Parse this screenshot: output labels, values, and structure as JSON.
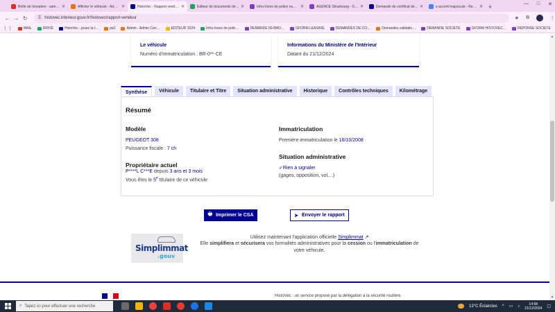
{
  "browser": {
    "tabs": [
      {
        "title": "Boîte de réception - sam…",
        "color": "#d93025",
        "active": false
      },
      {
        "title": "Afficher le véhicule - Adm…",
        "color": "#e8730c",
        "active": false
      },
      {
        "title": "HistoVec - Rapport vendeur",
        "color": "#000091",
        "active": true
      },
      {
        "title": "Editeur de documents de…",
        "color": "#1aa260",
        "active": false
      },
      {
        "title": "Infos livres de police num…",
        "color": "#7b3fbf",
        "active": false
      },
      {
        "title": "AGENCE Strasbourg - Gm…",
        "color": "#7b3fbf",
        "active": false
      },
      {
        "title": "Demande de certificat de…",
        "color": "#000091",
        "active": false
      },
      {
        "title": "e accent majuscule - Rech…",
        "color": "#4285f4",
        "active": false
      }
    ],
    "new_tab": "+",
    "url": "histovec.interieur.gouv.fr/histovec/rapport-vendeur",
    "bookmarks": [
      {
        "label": "MAIL",
        "color": "#d93025"
      },
      {
        "label": "DRIVE",
        "color": "#1aa260"
      },
      {
        "label": "HistoVec - jouez la t…",
        "color": "#000091"
      },
      {
        "label": "pa2",
        "color": "#e8730c"
      },
      {
        "label": "Admin - Admin Cen…",
        "color": "#e8730c"
      },
      {
        "label": "EDITEUR 2024",
        "color": "#f4b400"
      },
      {
        "label": "Infos livres de polic…",
        "color": "#1aa260"
      },
      {
        "label": "DEMANDE 60-8MO…",
        "color": "#7b3fbf"
      },
      {
        "label": "GFORM LEASING",
        "color": "#7b3fbf"
      },
      {
        "label": "DEMANDES DE CO…",
        "color": "#7b3fbf"
      },
      {
        "label": "Demandes validatio…",
        "color": "#e8730c"
      },
      {
        "label": "DEMANDE SOCIETE",
        "color": "#7b3fbf"
      },
      {
        "label": "GFORM HISTOVEC…",
        "color": "#7b3fbf"
      },
      {
        "label": "REPONSE SOCIETE",
        "color": "#7b3fbf"
      }
    ]
  },
  "cards": {
    "vehicle": {
      "title": "Le véhicule",
      "sub": "Numéro d'immatriculation : BR-0**-CE"
    },
    "ministry": {
      "title": "Informations du Ministère de l'Intérieur",
      "sub": "Datant du 21/12/2024"
    }
  },
  "tabs": [
    "Synthèse",
    "Véhicule",
    "Titulaire et Titre",
    "Situation administrative",
    "Historique",
    "Contrôles techniques",
    "Kilométrage"
  ],
  "summary": {
    "title": "Résumé",
    "model": {
      "heading": "Modèle",
      "name": "PEUGEOT 308",
      "power_label": "Puissance fiscale : ",
      "power_value": "7 ch"
    },
    "registration": {
      "heading": "Immatriculation",
      "first_label": "Première immatriculation le ",
      "first_value": "16/10/2008"
    },
    "owner": {
      "heading": "Propriétaire actuel",
      "name": "P****L C***E",
      "since_label": " depuis ",
      "since_value": "3 ans et 3 mois",
      "rank_prefix": "Vous êtes le ",
      "rank_value": "5",
      "rank_sup": "e",
      "rank_suffix": " titulaire de ce véhicule"
    },
    "admin": {
      "heading": "Situation administrative",
      "status": "Rien à signaler",
      "detail": "(gages, opposition, vol,...)"
    }
  },
  "actions": {
    "print": "Imprimer le CSA",
    "send": "Envoyer le rapport"
  },
  "promo": {
    "line1_prefix": "Utilisez maintenant l'application officielle ",
    "line1_link": "Simplimmat",
    "line2_a": "Elle ",
    "line2_b": "simplifiera",
    "line2_c": " et ",
    "line2_d": "sécurisera",
    "line2_e": " vos formalités administratives pour la ",
    "line2_f": "cession",
    "line2_g": " ou l'",
    "line2_h": "immatriculation",
    "line2_i": " de",
    "line3": "votre véhicule.",
    "logo_top": "Simplimmat",
    "logo_bottom": ".gouv"
  },
  "footer": {
    "text": "HistoVec : un service proposé par la délégation à la sécurité routière."
  },
  "taskbar": {
    "search_placeholder": "Tapez ici pour effectuer une recherche",
    "weather": "13°C  Éclaircies",
    "time": "14:58",
    "date": "21/12/2024"
  }
}
